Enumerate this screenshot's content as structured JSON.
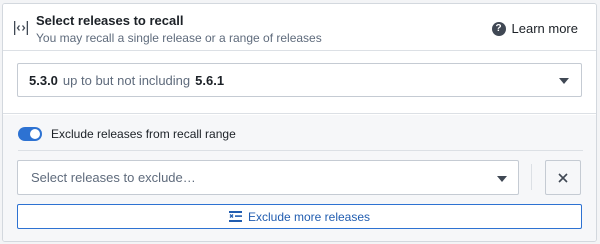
{
  "header": {
    "title": "Select releases to recall",
    "subtitle": "You may recall a single release or a range of releases",
    "learn_more_label": "Learn more",
    "icon": "code-brackets-icon"
  },
  "range": {
    "start_version": "5.3.0",
    "connector_text": "up to but not including",
    "end_version": "5.6.1"
  },
  "exclude": {
    "toggle_label": "Exclude releases from recall range",
    "toggle_on": true,
    "select_placeholder": "Select releases to exclude…",
    "clear_icon": "close-icon",
    "more_button_label": "Exclude more releases",
    "more_button_icon": "exclude-list-icon"
  },
  "colors": {
    "accent": "#2d72d2",
    "link": "#215db0",
    "border": "#c5cbd3"
  }
}
